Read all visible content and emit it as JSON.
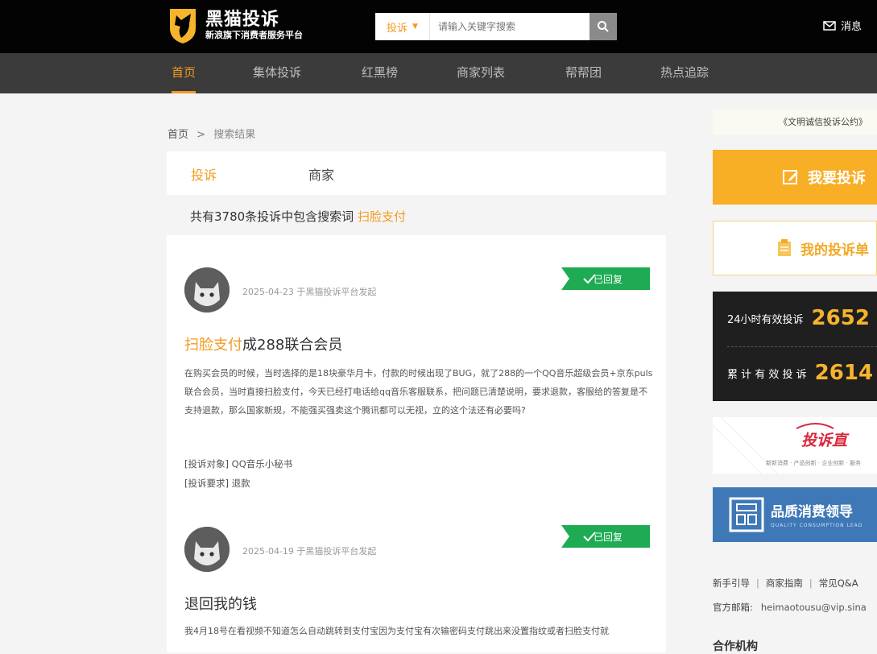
{
  "header": {
    "logo_title": "黑猫投诉",
    "logo_subtitle": "新浪旗下消费者服务平台",
    "search_type": "投诉",
    "search_placeholder": "请输入关键字搜索",
    "message_label": "消息"
  },
  "nav": {
    "items": [
      {
        "label": "首页"
      },
      {
        "label": "集体投诉"
      },
      {
        "label": "红黑榜"
      },
      {
        "label": "商家列表"
      },
      {
        "label": "帮帮团"
      },
      {
        "label": "热点追踪"
      }
    ]
  },
  "breadcrumb": {
    "home": "首页",
    "separator": ">",
    "current": "搜索结果"
  },
  "tabs": {
    "items": [
      {
        "label": "投诉"
      },
      {
        "label": "商家"
      }
    ]
  },
  "summary": {
    "prefix": "共有3780条投诉中包含搜索词",
    "keyword": "扫脸支付"
  },
  "complaints": [
    {
      "meta": "2025-04-23 于黑猫投诉平台发起",
      "status": "已回复",
      "title_keyword": "扫脸支付",
      "title_rest": "成288联合会员",
      "body": "在购买会员的时候，当时选择的是18块豪华月卡，付款的时候出现了BUG，就了288的一个QQ音乐超级会员+京东puls联合会员，当时直接扫脸支付，今天已经打电话给qq音乐客服联系，把问题已清楚说明，要求退款，客服给的答复是不支持退款，那么国家新规，不能强买强卖这个腾讯都可以无视，立的这个法还有必要吗?",
      "target_label": "[投诉对象]",
      "target_value": "QQ音乐小秘书",
      "demand_label": "[投诉要求]",
      "demand_value": "退款"
    },
    {
      "meta": "2025-04-19 于黑猫投诉平台发起",
      "status": "已回复",
      "title_keyword": "",
      "title_rest": "退回我的钱",
      "body": "我4月18号在看视频不知道怎么自动跳转到支付宝因为支付宝有次输密码支付跳出来没置指纹或者扫脸支付就"
    }
  ],
  "sidebar": {
    "notice": "《文明诚信投诉公约》",
    "complain_button": "我要投诉",
    "my_list_button": "我的投诉单",
    "stats": [
      {
        "label": "24小时有效投诉",
        "value": "2652"
      },
      {
        "label": "累 计 有 效 投 诉",
        "value": "2614"
      }
    ],
    "banner1_logo": "投诉直",
    "banner1_sub": "新新消费 · 产品创新 · 企业创新 · 服务",
    "banner2_title": "品质消费领导",
    "banner2_sub": "QUALITY CONSUMPTION LEAD",
    "links": [
      "新手引导",
      "商家指南",
      "常见Q&A"
    ],
    "email_label": "官方邮箱:",
    "email_value": "heimaotousu@vip.sina",
    "partners_title": "合作机构"
  },
  "colors": {
    "accent": "#f39a1f",
    "header_bg": "#030303",
    "nav_bg": "#3b3b3b",
    "status_green": "#1eab53"
  }
}
